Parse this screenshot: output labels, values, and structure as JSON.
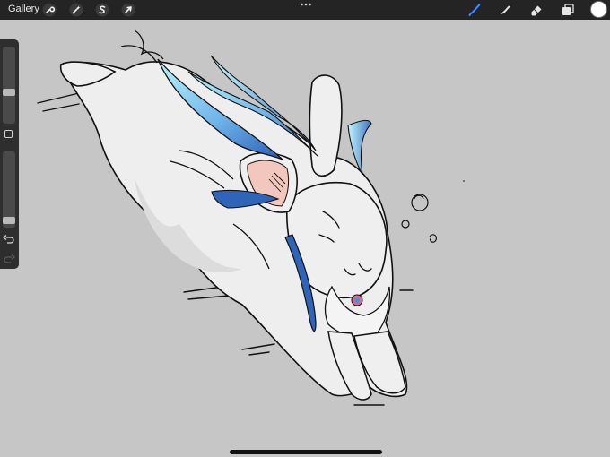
{
  "topbar": {
    "gallery_label": "Gallery",
    "left_tools": [
      {
        "name": "actions",
        "icon": "wrench-icon"
      },
      {
        "name": "adjustments",
        "icon": "magic-wand-icon"
      },
      {
        "name": "selection",
        "icon": "selection-s-icon"
      },
      {
        "name": "transform",
        "icon": "arrow-cursor-icon"
      }
    ],
    "more_icon": "ellipsis-icon",
    "right_tools": [
      {
        "name": "brush",
        "icon": "brush-icon",
        "active": true
      },
      {
        "name": "smudge",
        "icon": "smudge-icon",
        "active": false
      },
      {
        "name": "eraser",
        "icon": "eraser-icon",
        "active": false
      },
      {
        "name": "layers",
        "icon": "layers-icon",
        "active": false
      }
    ],
    "current_color": "#ffffff",
    "active_tool_color": "#3f8cff"
  },
  "sidebar": {
    "brush_size_level": 0.4,
    "opacity_level": 0.05,
    "modifier_icon": "square-modifier-icon",
    "undo_icon": "undo-icon",
    "redo_icon": "redo-icon"
  },
  "colors": {
    "canvas_background": "#c6c6c6",
    "fur": "#ececec",
    "ear_inner": "#f2c7bd",
    "hair_blue": "#2f64b8",
    "hair_cyan": "#aef1f6"
  }
}
